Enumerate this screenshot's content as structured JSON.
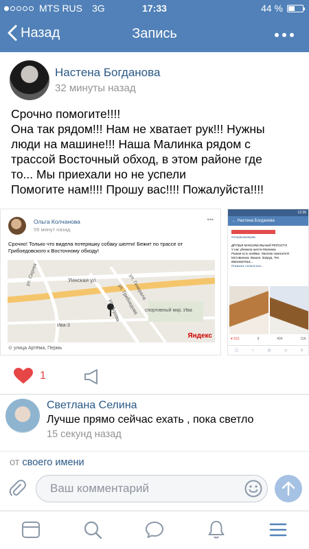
{
  "statusbar": {
    "carrier": "MTS RUS",
    "network": "3G",
    "time": "17:33",
    "battery": "44 %",
    "battery_level": 0.44
  },
  "navbar": {
    "back_label": "Назад",
    "title": "Запись"
  },
  "post": {
    "author": "Настена Богданова",
    "time": "32 минуты назад",
    "text_lines": [
      "Срочно помогите!!!!",
      "Она так рядом!!! Нам не хватает рук!!! Нужны",
      "люди на машине!!! Наша Малинка рядом с",
      "трассой Восточный обход, в этом районе где",
      "то... Мы приехали но не успели",
      "Помогите нам!!!! Прошу вас!!!! Пожалуйста!!!!"
    ],
    "likes": "1"
  },
  "shot1": {
    "author": "Ольга Колчанова",
    "time": "59 минут назад",
    "menu": "•••",
    "text": "Срочно! Только что видела потеряшку собаку шелти! Бежит по трассе от Грибоедовского к Восточному обходу!",
    "map_labels": [
      "Уинская ул.",
      "ул. Генерала",
      "спортивный мкр. Ива",
      "Ива-3",
      "ул. Агрова",
      "ул. Грибоедова",
      "ул. Сергея"
    ],
    "map_brand": "Яндекс",
    "location": "улица Артёма, Пермь"
  },
  "shot2": {
    "status_time": "12:36",
    "nav_title": "Настена Богданова",
    "hashtag": "#отеряшкапермь",
    "heading": "ДРУЗЬЯ МАКСИМАЛЬНЫЙ РЕПОСТ!!!",
    "lines": [
      "У нас убежала шелти Малинка",
      "Рыжая есть клеймо. Умоляю помогите!!!",
      "Мотовилиха. Вишня. Запруд. Тел",
      "89024607016..."
    ],
    "show_more": "Показать полностью...",
    "likes": "631",
    "comments": "9",
    "shares": "494",
    "views": "11K"
  },
  "comment": {
    "author": "Светлана Селина",
    "text": "Лучше прямо сейчас ехать , пока светло",
    "time": "15 секунд назад"
  },
  "composer": {
    "from_prefix": "от",
    "from_link": "своего имени",
    "placeholder": "Ваш комментарий"
  },
  "colors": {
    "brand": "#5181b8",
    "link": "#2a5885",
    "like": "#e64646",
    "send": "#a5c1e3"
  }
}
